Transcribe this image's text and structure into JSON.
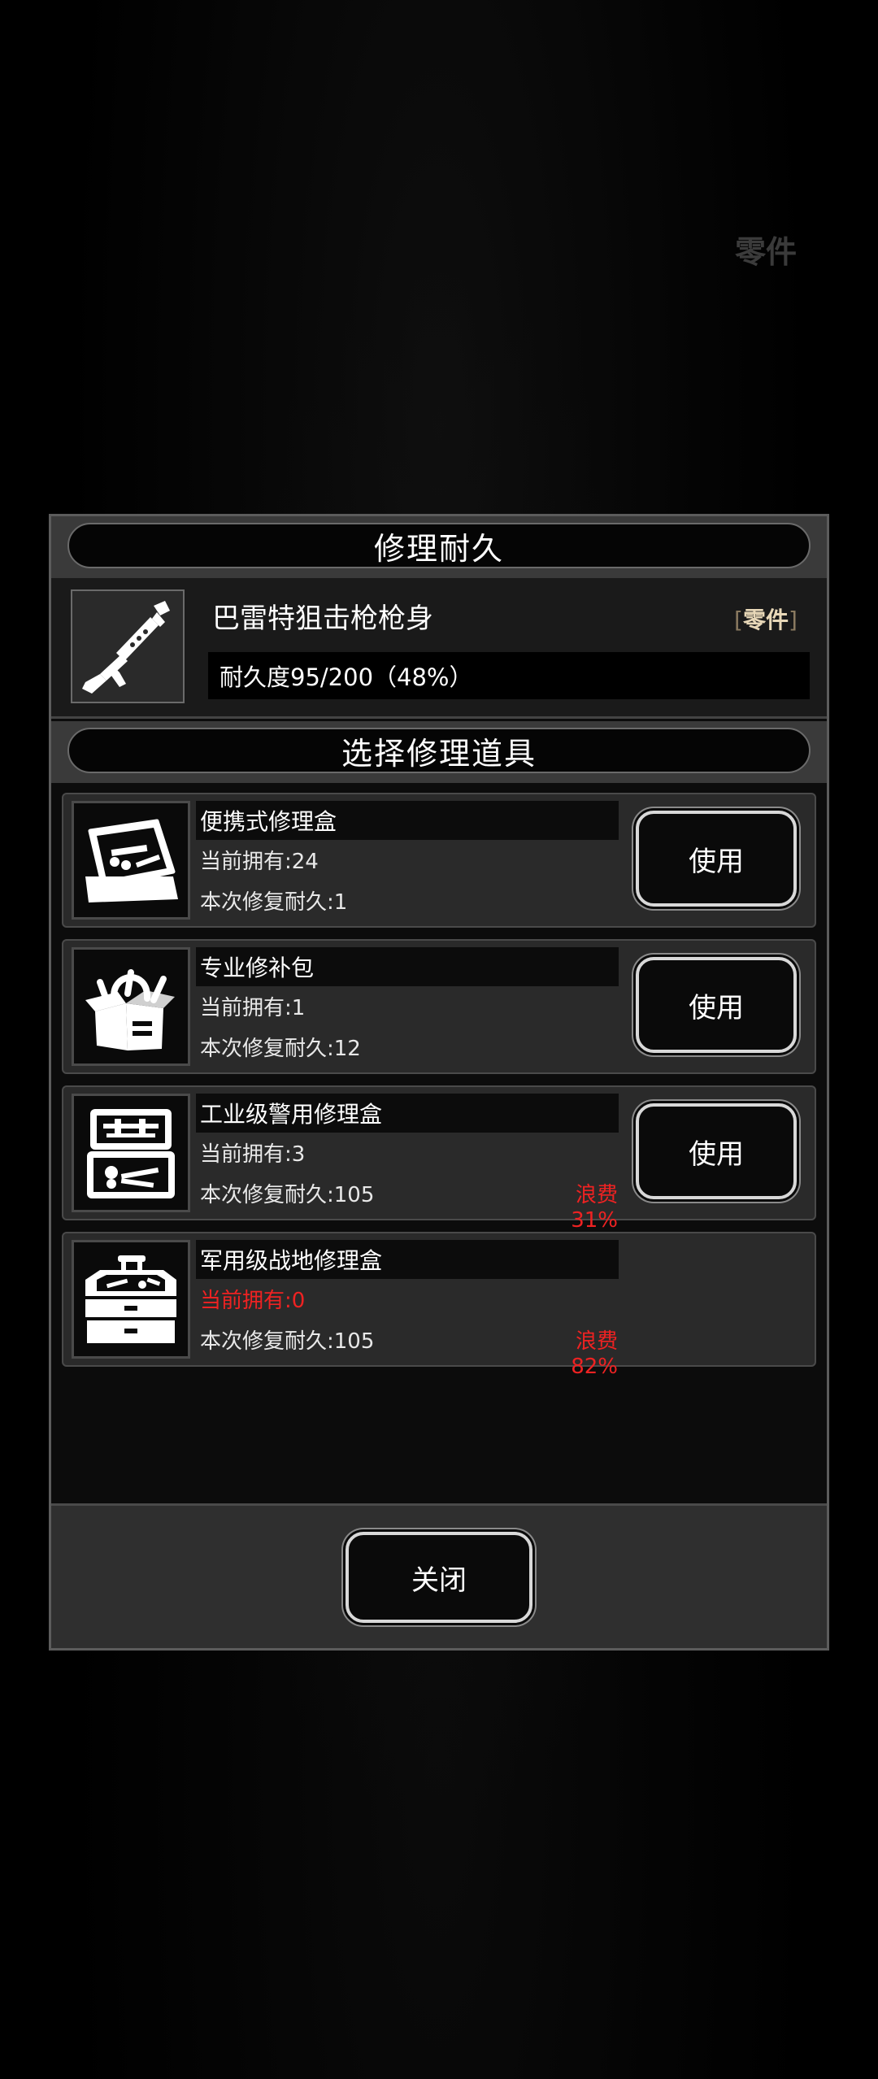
{
  "background": {
    "tag": "零件"
  },
  "dialog": {
    "title": "修理耐久",
    "item": {
      "name": "巴雷特狙击枪枪身",
      "tag_open": "[",
      "tag": "零件",
      "tag_close": "]",
      "durability": "耐久度95/200（48%）",
      "icon": "rifle-body-icon"
    },
    "section_title": "选择修理道具",
    "tools": [
      {
        "name": "便携式修理盒",
        "owned": "当前拥有:24",
        "repair": "本次修复耐久:1",
        "waste": "",
        "button": "使用",
        "icon": "portable-repair-box-icon"
      },
      {
        "name": "专业修补包",
        "owned": "当前拥有:1",
        "repair": "本次修复耐久:12",
        "waste": "",
        "button": "使用",
        "icon": "professional-repair-kit-icon"
      },
      {
        "name": "工业级警用修理盒",
        "owned": "当前拥有:3",
        "repair": "本次修复耐久:105",
        "waste": "浪费31%",
        "button": "使用",
        "icon": "industrial-repair-case-icon"
      },
      {
        "name": "军用级战地修理盒",
        "owned": "当前拥有:0",
        "repair": "本次修复耐久:105",
        "waste": "浪费82%",
        "button": "",
        "icon": "military-toolbox-icon"
      }
    ],
    "close_label": "关闭"
  },
  "colors": {
    "warning": "#e22222",
    "tag": "#d8c39a"
  }
}
